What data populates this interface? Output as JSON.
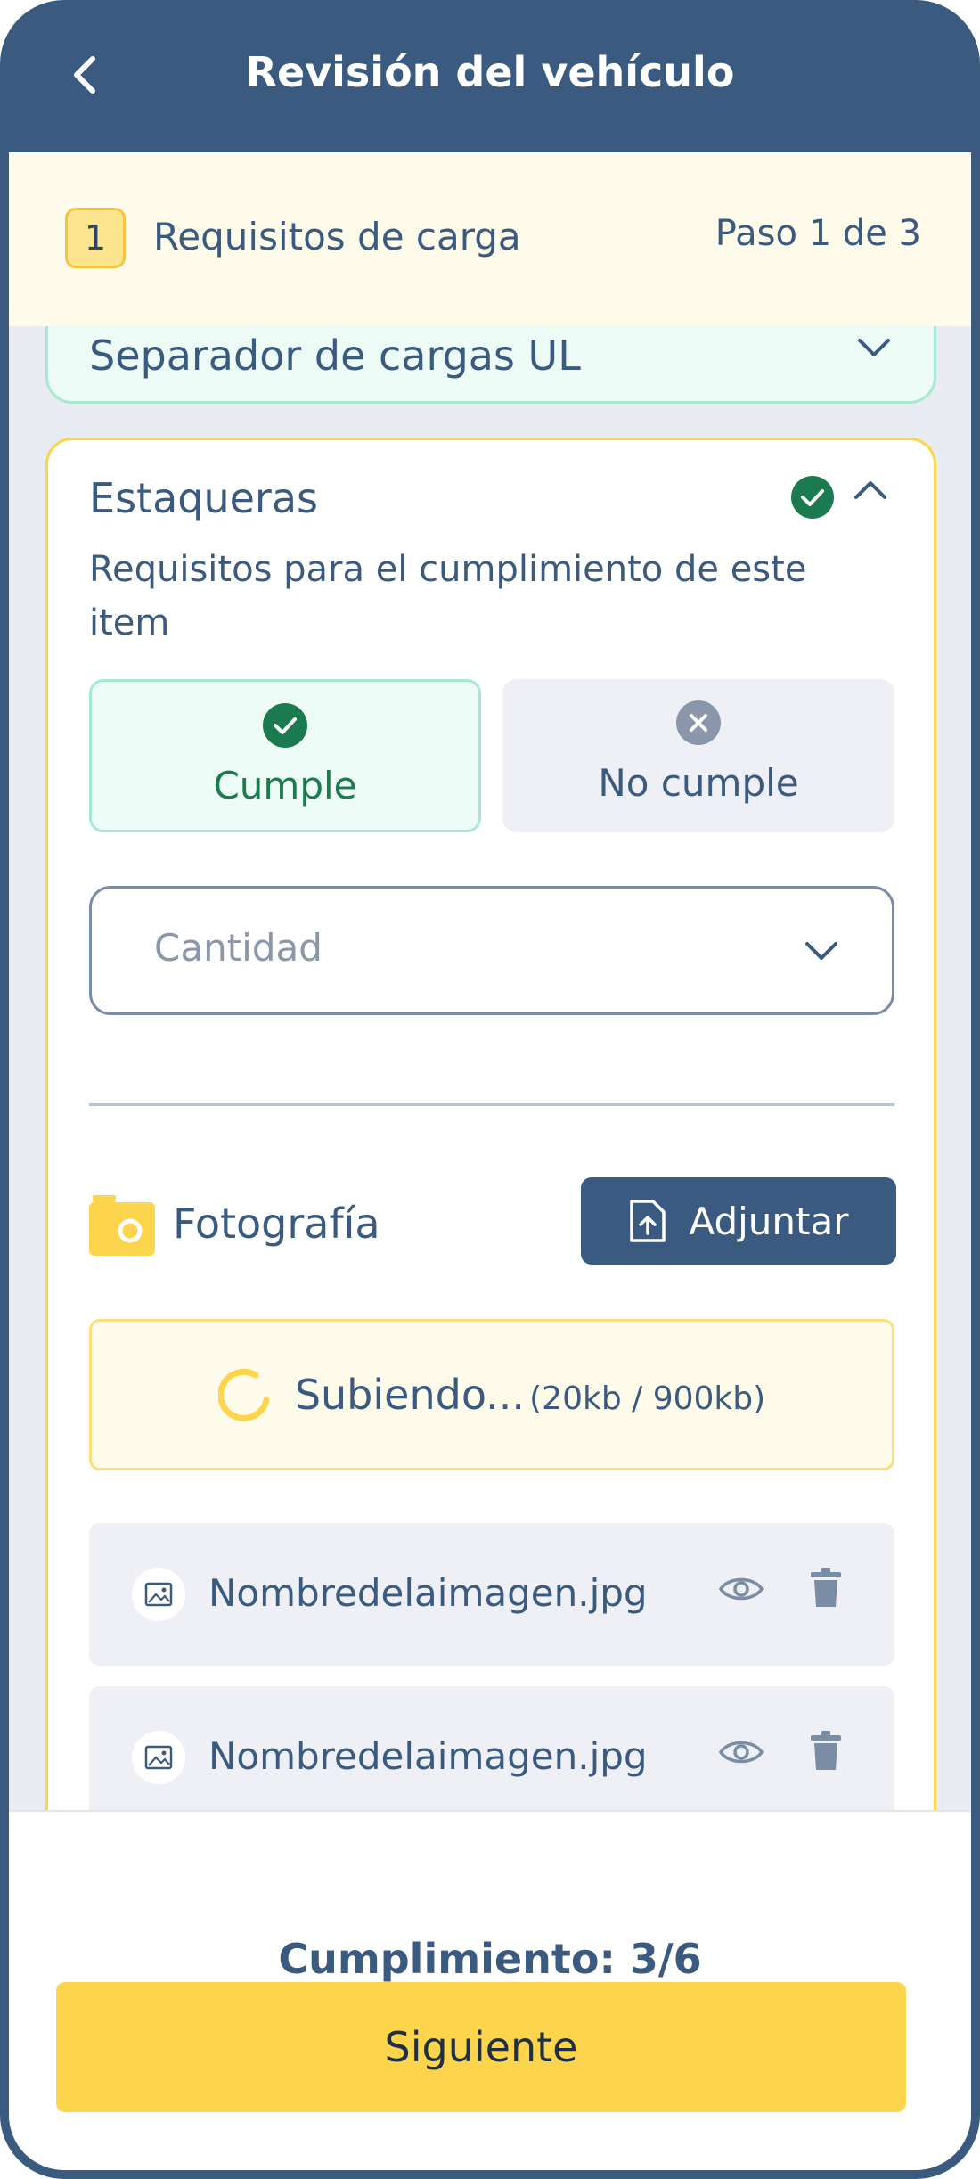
{
  "header": {
    "title": "Revisión del vehículo"
  },
  "step": {
    "number": "1",
    "title": "Requisitos de carga",
    "counter": "Paso 1 de 3"
  },
  "collapsed_item": {
    "title": "Separador de cargas UL"
  },
  "item": {
    "title": "Estaqueras",
    "description": "Requisitos para  el cumplimiento de este item",
    "options": {
      "comply": "Cumple",
      "not_comply": "No cumple"
    },
    "quantity_placeholder": "Cantidad",
    "photo_label": "Fotografía",
    "attach_label": "Adjuntar",
    "upload": {
      "status": "Subiendo...",
      "progress": "(20kb / 900kb)"
    },
    "files": [
      {
        "name": "Nombredelaimagen.jpg"
      },
      {
        "name": "Nombredelaimagen.jpg"
      }
    ]
  },
  "footer": {
    "progress": "Cumplimiento: 3/6",
    "next_label": "Siguiente"
  }
}
